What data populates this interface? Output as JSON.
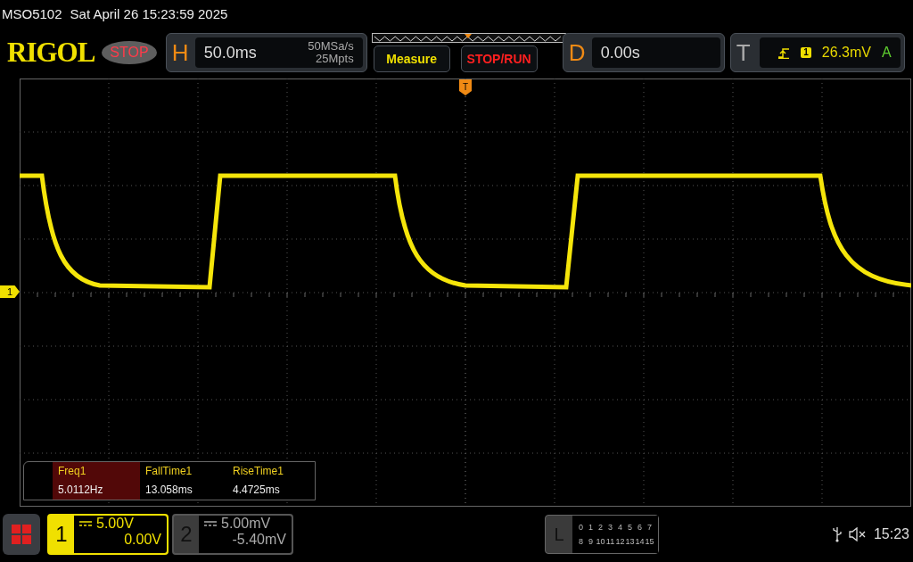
{
  "status_line": {
    "model": "MSO5102",
    "datetime": "Sat April 26 15:23:59 2025"
  },
  "header": {
    "logo": "RIGOL",
    "run_state": "STOP",
    "horizontal": {
      "label": "H",
      "timebase": "50.0ms",
      "sample_rate": "50MSa/s",
      "memory_depth": "25Mpts"
    },
    "buttons": [
      "Measure",
      "STOP/RUN"
    ],
    "delay": {
      "label": "D",
      "value": "0.00s"
    },
    "trigger": {
      "label": "T",
      "source": "1",
      "level": "26.3mV",
      "mode": "A"
    }
  },
  "trigger_marker": "T",
  "channel_marker": "1",
  "measurements": [
    {
      "name": "Freq1",
      "value": "5.0112Hz",
      "selected": true
    },
    {
      "name": "FallTime1",
      "value": "13.058ms",
      "selected": false
    },
    {
      "name": "RiseTime1",
      "value": "4.4725ms",
      "selected": false
    }
  ],
  "channels": [
    {
      "number": "1",
      "scale": "5.00V",
      "offset": "0.00V",
      "active": true
    },
    {
      "number": "2",
      "scale": "5.00mV",
      "offset": "-5.40mV",
      "active": false
    }
  ],
  "logic": {
    "label": "L",
    "rows": [
      [
        "0",
        "1",
        "2",
        "3",
        "4",
        "5",
        "6",
        "7"
      ],
      [
        "8",
        "9",
        "10",
        "11",
        "12",
        "13",
        "14",
        "15"
      ]
    ]
  },
  "clock": "15:23"
}
